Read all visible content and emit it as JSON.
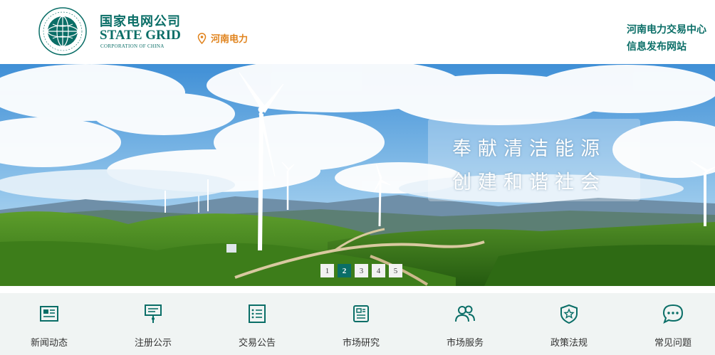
{
  "header": {
    "logo_cn": "国家电网公司",
    "logo_en": "STATE GRID",
    "logo_sub": "CORPORATION OF CHINA",
    "emblem_text": "国家电网公司 STATE GRID CORPORATION OF CHINA",
    "location": "河南电力",
    "site_title_line1": "河南电力交易中心",
    "site_title_line2": "信息发布网站"
  },
  "banner": {
    "slogan_line1": "奉献清洁能源",
    "slogan_line2": "创建和谐社会",
    "pager": [
      "1",
      "2",
      "3",
      "4",
      "5"
    ],
    "active_page": 2
  },
  "nav": {
    "items": [
      {
        "label": "新闻动态",
        "icon": "newspaper-icon"
      },
      {
        "label": "注册公示",
        "icon": "signboard-icon"
      },
      {
        "label": "交易公告",
        "icon": "list-icon"
      },
      {
        "label": "市场研究",
        "icon": "report-icon"
      },
      {
        "label": "市场服务",
        "icon": "users-icon"
      },
      {
        "label": "政策法规",
        "icon": "shield-star-icon"
      },
      {
        "label": "常见问题",
        "icon": "chat-bubble-icon"
      }
    ]
  },
  "colors": {
    "brand": "#0a6e67",
    "accent": "#e0821b"
  }
}
